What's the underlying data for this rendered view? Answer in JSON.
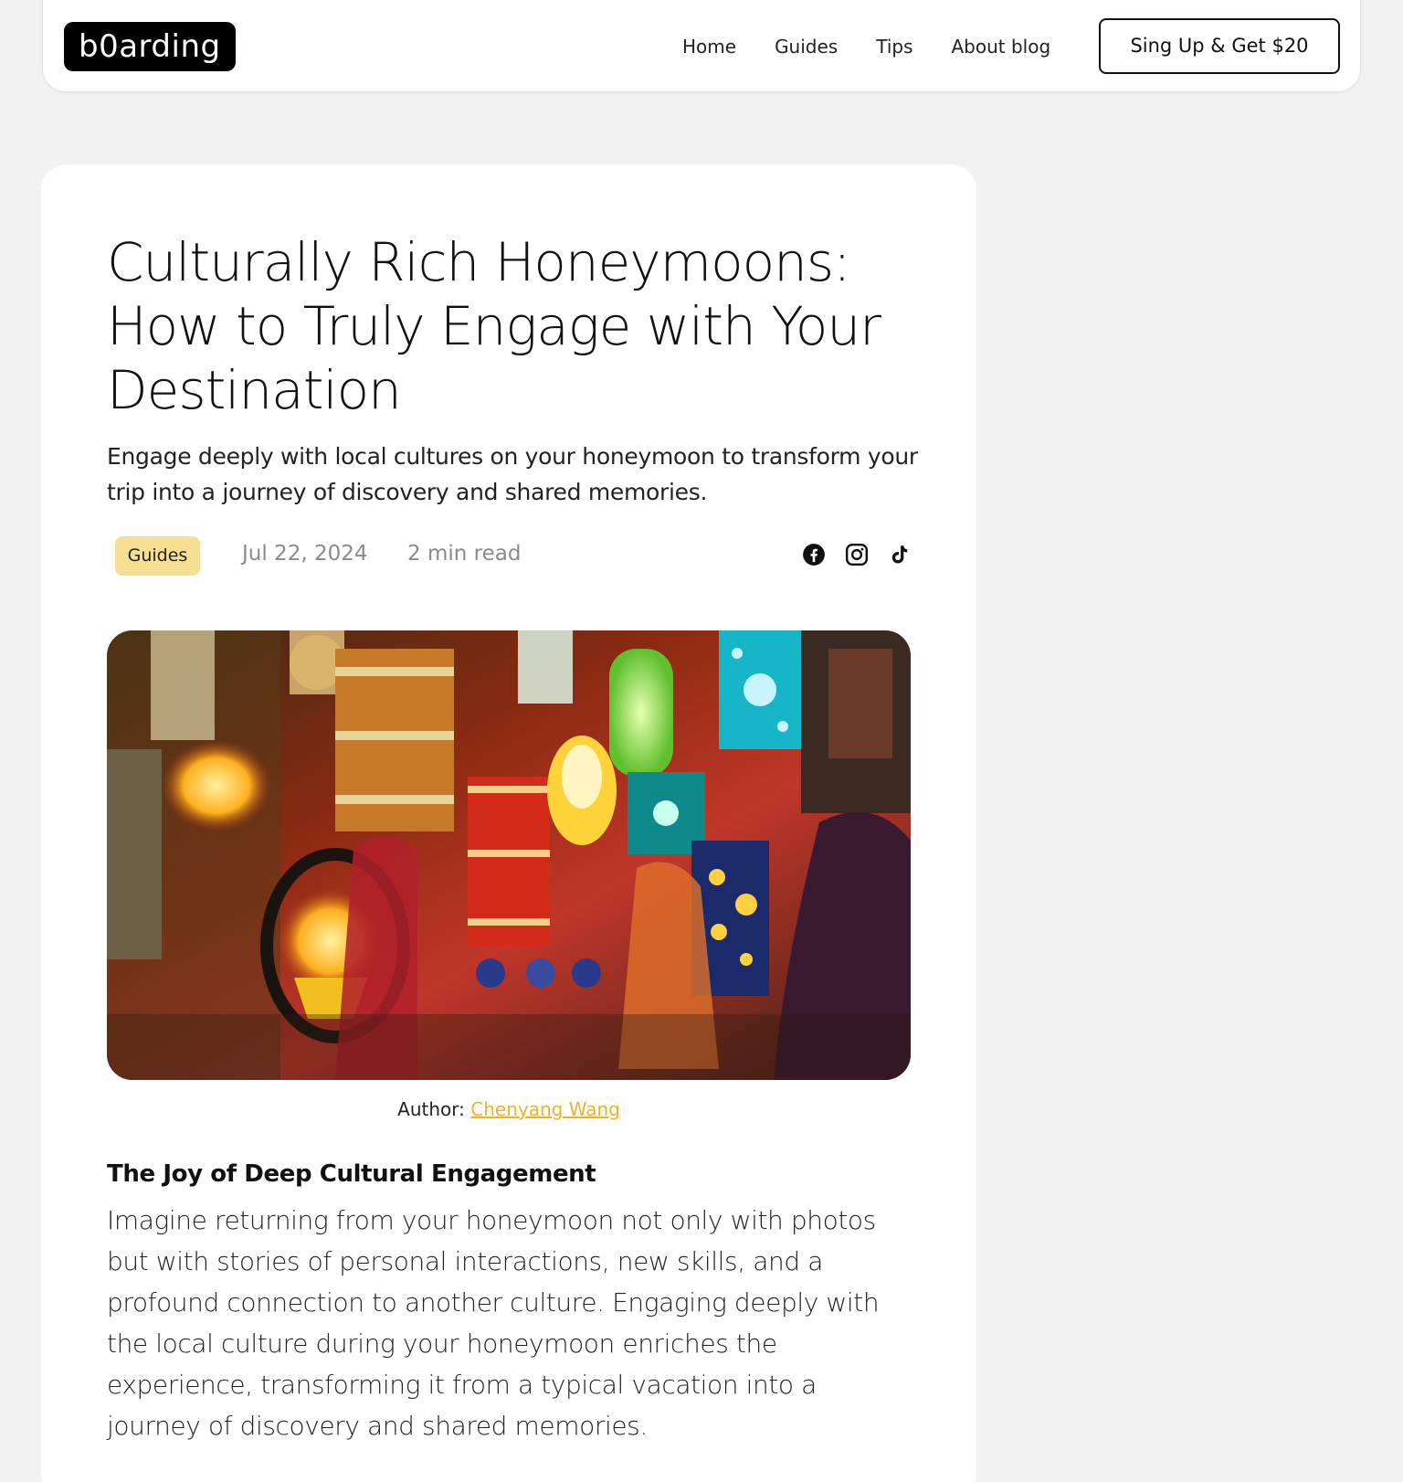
{
  "header": {
    "logo": "b0arding",
    "nav": [
      "Home",
      "Guides",
      "Tips",
      "About blog"
    ],
    "cta_label": "Sing Up & Get $20"
  },
  "article": {
    "title": "Culturally Rich Honeymoons: How to Truly Engage with Your Destination",
    "subtitle": "Engage deeply with local cultures on your honeymoon to transform your trip into a journey of discovery and shared memories.",
    "category": "Guides",
    "date": "Jul 22, 2024",
    "read_time": "2 min read",
    "social_icons": [
      "facebook-icon",
      "instagram-icon",
      "tiktok-icon"
    ],
    "image_caption_prefix": "Author: ",
    "image_author": "Chenyang Wang",
    "section_title": "The Joy of Deep Cultural Engagement",
    "paragraph": "Imagine returning from your honeymoon not only with photos but with stories of personal interactions, new skills, and a profound connection to another culture. Engaging deeply with the local culture during your honeymoon enriches the experience, transforming it from a typical vacation into a journey of discovery and shared memories."
  },
  "colors": {
    "page_bg": "#f2f2f2",
    "badge_bg": "#f6df92",
    "link": "#f0b12b"
  }
}
